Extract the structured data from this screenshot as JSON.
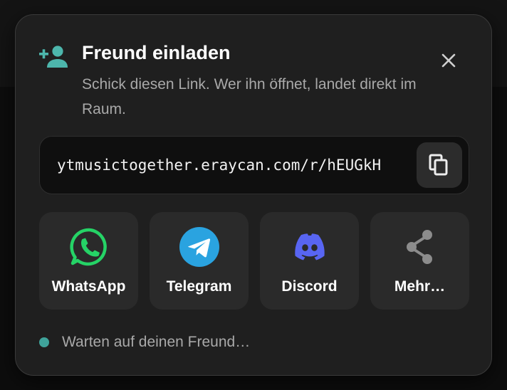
{
  "modal": {
    "title": "Freund einladen",
    "subtitle": "Schick diesen Link. Wer ihn öffnet, landet direkt im Raum.",
    "icon": "person-add-icon",
    "close_icon": "close-icon"
  },
  "link": {
    "url": "ytmusictogether.eraycan.com/r/hEUGkH",
    "copy_icon": "copy-icon"
  },
  "share": [
    {
      "label": "WhatsApp",
      "icon": "whatsapp-icon",
      "color": "#25d366"
    },
    {
      "label": "Telegram",
      "icon": "telegram-icon",
      "color": "#2aa3e0"
    },
    {
      "label": "Discord",
      "icon": "discord-icon",
      "color": "#5865f2"
    },
    {
      "label": "Mehr…",
      "icon": "share-icon",
      "color": "#8c8c8c"
    }
  ],
  "status": {
    "text": "Warten auf deinen Freund…",
    "dot_color": "#3fa39a"
  },
  "colors": {
    "accent": "#3fa39a",
    "panel": "#1f1f1f",
    "card": "#2a2a2a"
  }
}
